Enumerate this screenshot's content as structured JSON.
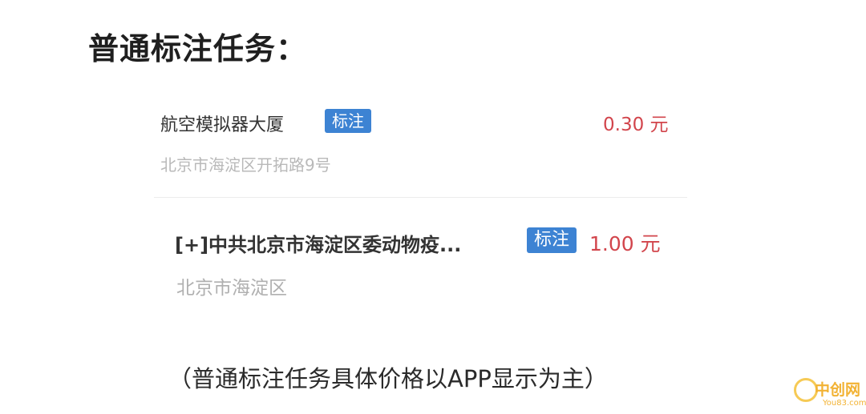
{
  "heading": "普通标注任务：",
  "tasks": [
    {
      "name": "航空模拟器大厦",
      "tag": "标注",
      "price": "0.30 元",
      "address": "北京市海淀区开拓路9号"
    },
    {
      "name": "[+]中共北京市海淀区委动物疫...",
      "tag": "标注",
      "price": "1.00 元",
      "address": "北京市海淀区"
    }
  ],
  "footnote": "（普通标注任务具体价格以APP显示为主）",
  "watermark": {
    "name": "中创网",
    "domain": "You83.com"
  },
  "colors": {
    "tag_background": "#3d83d3",
    "price": "#d2454c",
    "address": "#b9b9b9",
    "watermark": "#f2b233"
  }
}
